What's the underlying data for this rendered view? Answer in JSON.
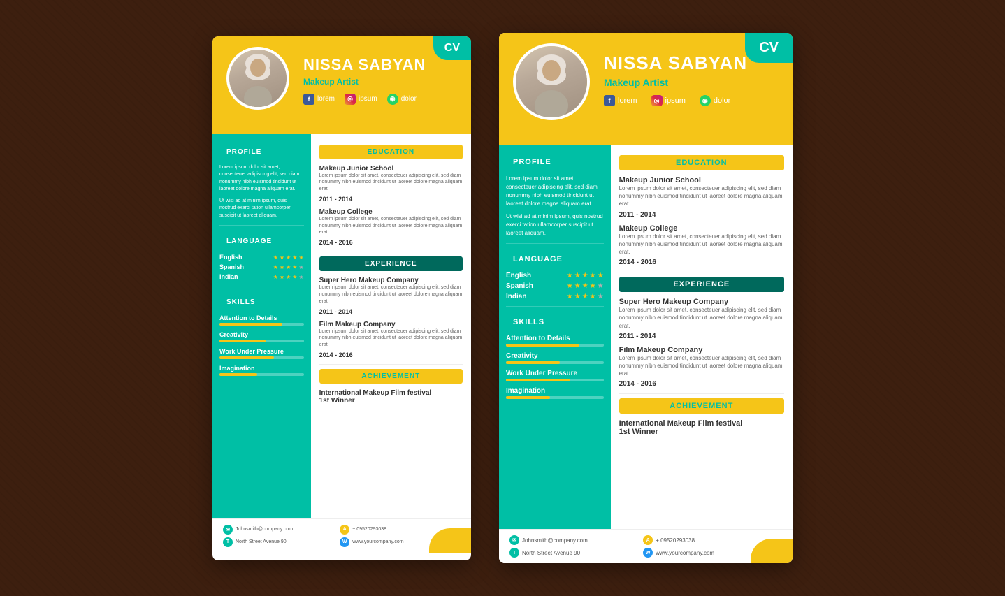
{
  "cv": {
    "tag": "CV",
    "name": "NISSA SABYAN",
    "title": "Makeup Artist",
    "social": [
      {
        "icon": "f",
        "type": "fb",
        "label": "lorem"
      },
      {
        "icon": "◎",
        "type": "ig",
        "label": "ipsum"
      },
      {
        "icon": "◉",
        "type": "wa",
        "label": "dolor"
      }
    ],
    "profile": {
      "heading": "PROFILE",
      "text1": "Lorem ipsum dolor sit amet, consecteuer adipiscing elit, sed diam nonummy nibh euismod tincidunt ut laoreet dolore magna aliquam erat.",
      "text2": "Ut wisi ad at minim ipsum, quis nostrud exerci tation ullamcorper suscipit ut laoreet aliquam."
    },
    "language": {
      "heading": "LANGUAGE",
      "items": [
        {
          "name": "English",
          "stars": 5,
          "filled": 5
        },
        {
          "name": "Spanish",
          "stars": 5,
          "filled": 4
        },
        {
          "name": "Indian",
          "stars": 5,
          "filled": 4
        }
      ]
    },
    "skills": {
      "heading": "SKILLS",
      "items": [
        {
          "name": "Attention to Details",
          "percent": 75
        },
        {
          "name": "Creativity",
          "percent": 55
        },
        {
          "name": "Work Under Pressure",
          "percent": 65
        },
        {
          "name": "Imagination",
          "percent": 45
        }
      ]
    },
    "education": {
      "heading": "EDUCATION",
      "items": [
        {
          "school": "Makeup Junior School",
          "desc": "Lorem ipsum dolor sit amet, consecteuer adipiscing elit, sed diam nonummy nibh euismod tincidunt ut laoreet dolore magna aliquam erat.",
          "year": "2011 - 2014"
        },
        {
          "school": "Makeup College",
          "desc": "Lorem ipsum dolor sit amet, consecteuer adipiscing elit, sed diam nonummy nibh euismod tincidunt ut laoreet dolore magna aliquam erat.",
          "year": "2014 - 2016"
        }
      ]
    },
    "experience": {
      "heading": "EXPERIENCE",
      "items": [
        {
          "company": "Super Hero Makeup Company",
          "desc": "Lorem ipsum dolor sit amet, consecteuer adipiscing elit, sed diam nonummy nibh euismod tincidunt ut laoreet dolore magna aliquam erat.",
          "year": "2011 - 2014"
        },
        {
          "company": "Film Makeup Company",
          "desc": "Lorem ipsum dolor sit amet, consecteuer adipiscing elit, sed diam nonummy nibh euismod tincidunt ut laoreet dolore magna aliquam erat.",
          "year": "2014 - 2016"
        }
      ]
    },
    "achievement": {
      "heading": "ACHIEVEMENT",
      "items": [
        "International Makeup Film festival",
        "1st Winner"
      ]
    },
    "footer": [
      {
        "icon": "✉",
        "type": "teal",
        "text": "Johnsmith@company.com"
      },
      {
        "icon": "A",
        "type": "yellow",
        "text": "+ 09520293038"
      },
      {
        "icon": "T",
        "type": "teal",
        "text": "North Street Avenue 90"
      },
      {
        "icon": "W",
        "type": "blue",
        "text": "www.yourcompany.com"
      }
    ]
  }
}
